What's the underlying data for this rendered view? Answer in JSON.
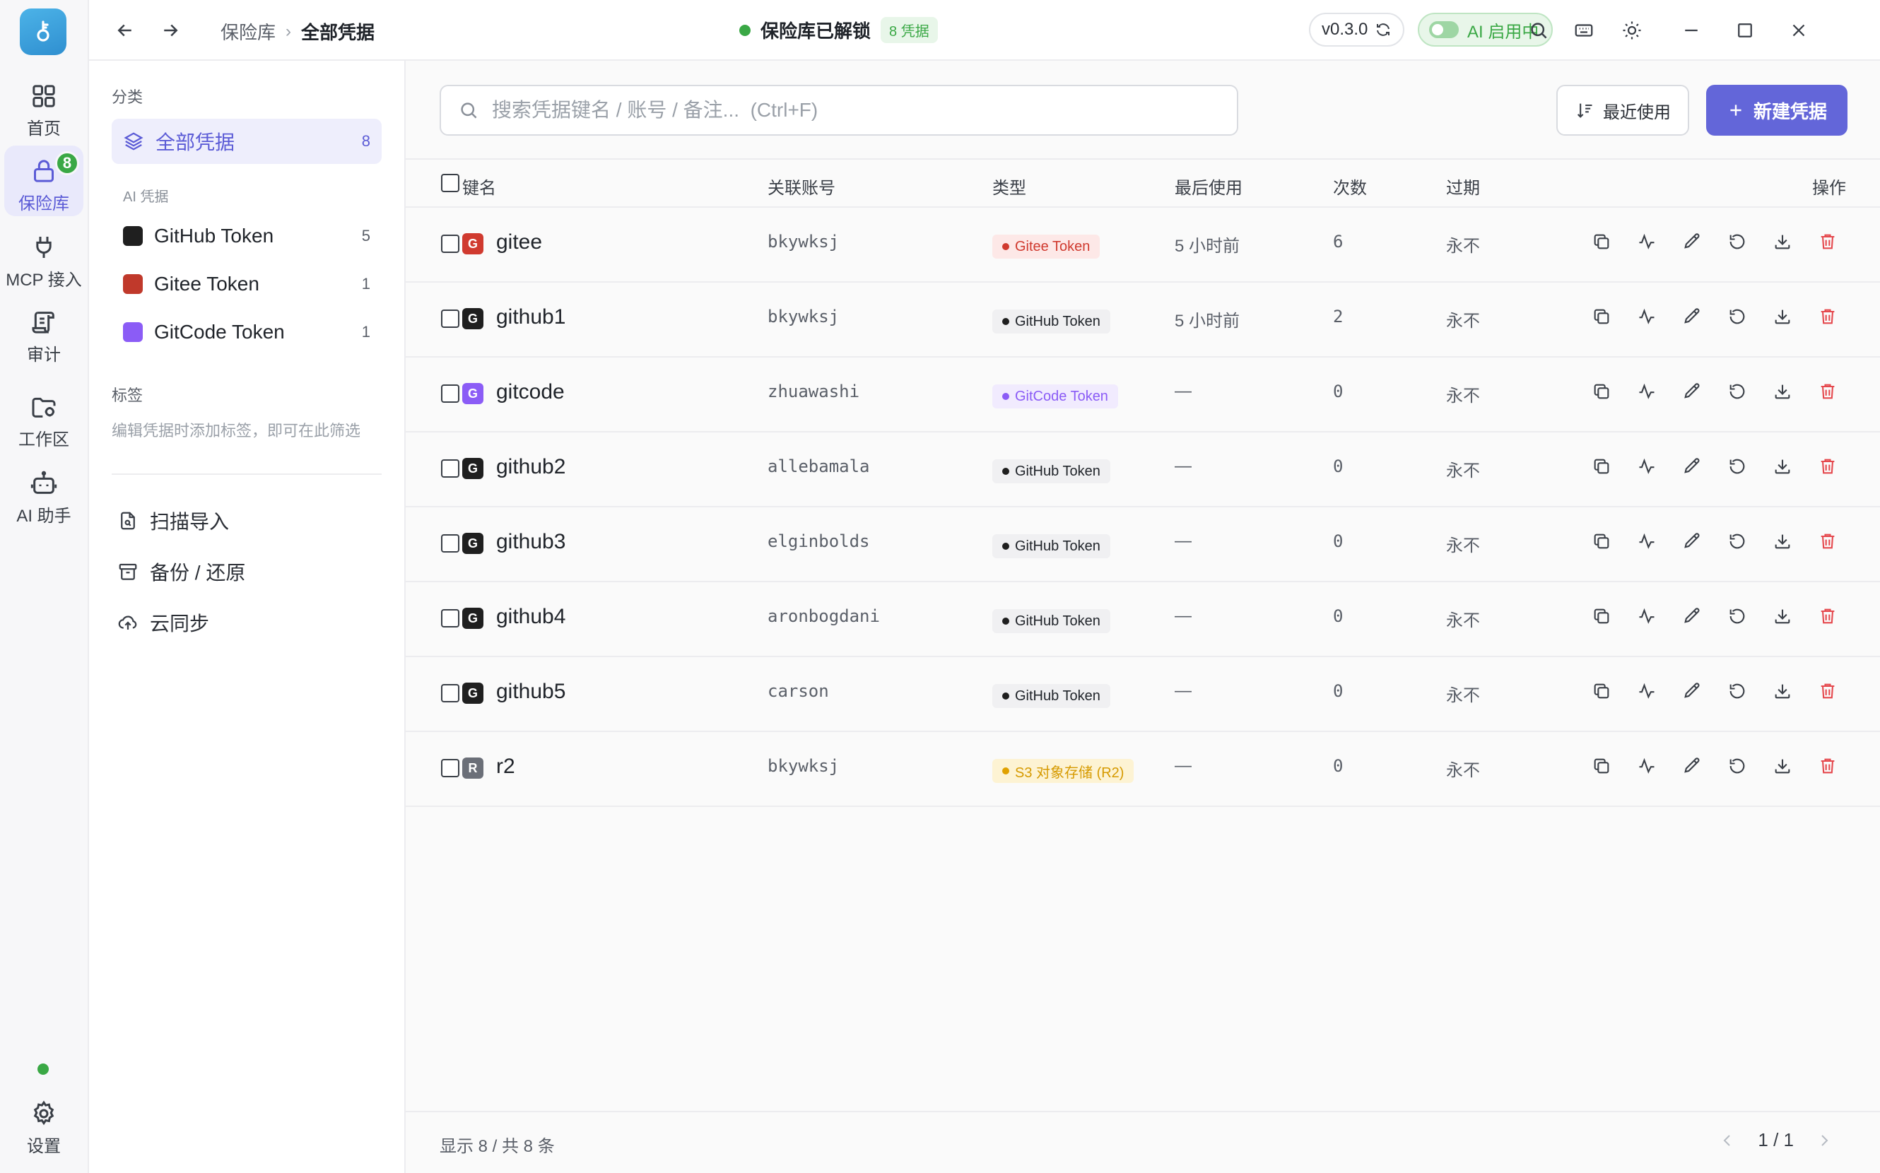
{
  "rail": {
    "items": [
      {
        "label": "首页",
        "icon": "grid-icon"
      },
      {
        "label": "保险库",
        "icon": "lock-icon",
        "badge": "8"
      },
      {
        "label": "MCP 接入",
        "icon": "plug-icon"
      },
      {
        "label": "审计",
        "icon": "scroll-icon"
      },
      {
        "label": "工作区",
        "icon": "folder-icon"
      },
      {
        "label": "AI 助手",
        "icon": "robot-icon"
      }
    ],
    "settings_label": "设置"
  },
  "topbar": {
    "breadcrumb": [
      "保险库",
      "全部凭据"
    ],
    "vault_status": "保险库已解锁",
    "vault_count": "8 凭据",
    "version": "v0.3.0",
    "ai_status": "AI 启用中"
  },
  "sidebar": {
    "category_title": "分类",
    "all_label": "全部凭据",
    "all_count": "8",
    "ai_title": "AI 凭据",
    "categories": [
      {
        "label": "GitHub Token",
        "count": "5",
        "color": "#1f1f1f"
      },
      {
        "label": "Gitee Token",
        "count": "1",
        "color": "#c0392b"
      },
      {
        "label": "GitCode Token",
        "count": "1",
        "color": "#8b5cf6"
      }
    ],
    "tags_title": "标签",
    "tags_hint": "编辑凭据时添加标签，即可在此筛选",
    "actions": [
      {
        "label": "扫描导入",
        "icon": "scan-file-icon"
      },
      {
        "label": "备份 / 还原",
        "icon": "archive-icon"
      },
      {
        "label": "云同步",
        "icon": "cloud-upload-icon"
      }
    ]
  },
  "main": {
    "search_placeholder": "搜索凭据键名 / 账号 / 备注...  (Ctrl+F)",
    "sort_label": "最近使用",
    "new_label": "新建凭据",
    "columns": {
      "name": "键名",
      "account": "关联账号",
      "type": "类型",
      "last_used": "最后使用",
      "count": "次数",
      "expiry": "过期",
      "actions": "操作"
    },
    "rows": [
      {
        "letter": "G",
        "letter_bg": "#d03a2f",
        "name": "gitee",
        "account": "bkywksj",
        "type": "Gitee Token",
        "type_kind": "gitee",
        "last_used": "5 小时前",
        "count": "6",
        "expiry": "永不"
      },
      {
        "letter": "G",
        "letter_bg": "#1f1f1f",
        "name": "github1",
        "account": "bkywksj",
        "type": "GitHub Token",
        "type_kind": "github",
        "last_used": "5 小时前",
        "count": "2",
        "expiry": "永不"
      },
      {
        "letter": "G",
        "letter_bg": "#8b5cf6",
        "name": "gitcode",
        "account": "zhuawashi",
        "type": "GitCode Token",
        "type_kind": "gitcode",
        "last_used": "—",
        "count": "0",
        "expiry": "永不"
      },
      {
        "letter": "G",
        "letter_bg": "#1f1f1f",
        "name": "github2",
        "account": "allebamala",
        "type": "GitHub Token",
        "type_kind": "github",
        "last_used": "—",
        "count": "0",
        "expiry": "永不"
      },
      {
        "letter": "G",
        "letter_bg": "#1f1f1f",
        "name": "github3",
        "account": "elginbolds",
        "type": "GitHub Token",
        "type_kind": "github",
        "last_used": "—",
        "count": "0",
        "expiry": "永不"
      },
      {
        "letter": "G",
        "letter_bg": "#1f1f1f",
        "name": "github4",
        "account": "aronbogdani",
        "type": "GitHub Token",
        "type_kind": "github",
        "last_used": "—",
        "count": "0",
        "expiry": "永不"
      },
      {
        "letter": "G",
        "letter_bg": "#1f1f1f",
        "name": "github5",
        "account": "carson",
        "type": "GitHub Token",
        "type_kind": "github",
        "last_used": "—",
        "count": "0",
        "expiry": "永不"
      },
      {
        "letter": "R",
        "letter_bg": "#6b6f78",
        "name": "r2",
        "account": "bkywksj",
        "type": "S3 对象存储 (R2)",
        "type_kind": "s3",
        "last_used": "—",
        "count": "0",
        "expiry": "永不"
      }
    ],
    "row_actions": [
      "copy-icon",
      "activity-icon",
      "edit-icon",
      "rotate-icon",
      "download-icon",
      "delete-icon"
    ],
    "footer_summary": "显示 8 / 共 8 条",
    "page_info": "1 / 1"
  },
  "colors": {
    "accent": "#5b5bd6",
    "primary_button": "#6366d9",
    "success": "#3aa845",
    "danger": "#e5484d"
  }
}
